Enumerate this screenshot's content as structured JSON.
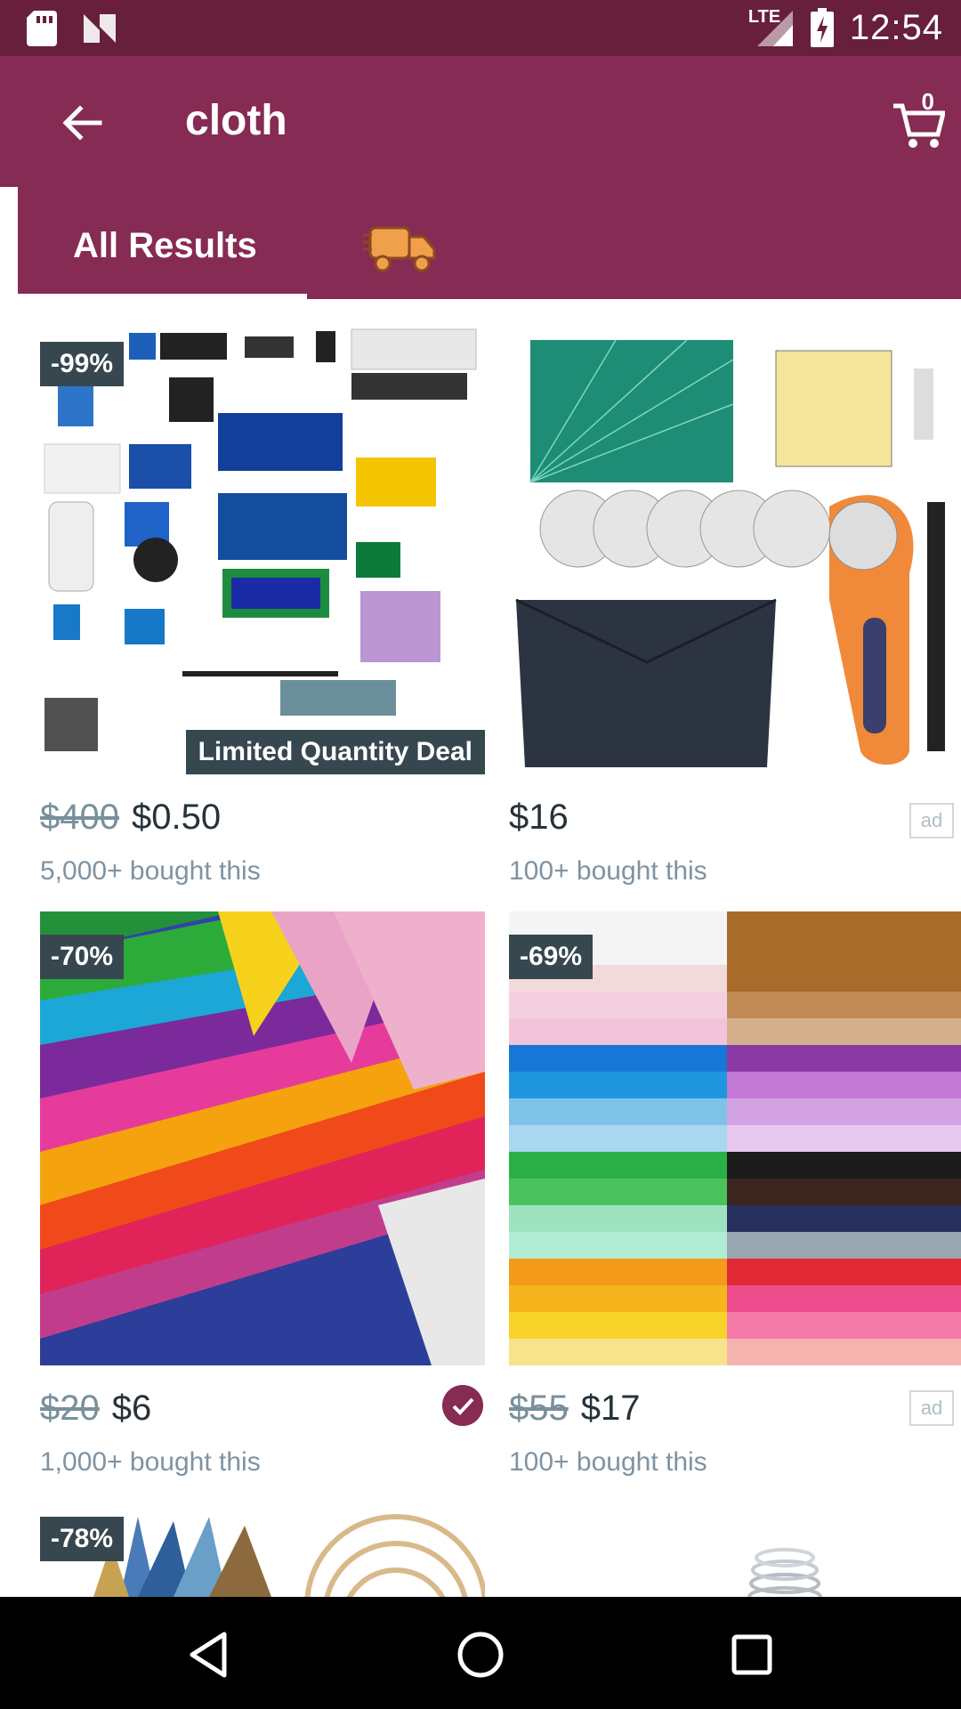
{
  "status_bar": {
    "time": "12:54",
    "network": "LTE",
    "icons": [
      "sd-card-icon",
      "n-icon",
      "signal-icon",
      "battery-charging-icon"
    ]
  },
  "app_bar": {
    "query": "cloth",
    "cart_count": "0",
    "icons": [
      "back-arrow-icon",
      "cart-icon"
    ]
  },
  "tabs": {
    "all_results": "All Results",
    "shipping_icon": "fast-shipping-truck-icon"
  },
  "products": [
    {
      "discount": "-99%",
      "deal": "Limited Quantity Deal",
      "old_price": "$400",
      "price": "$0.50",
      "bought": "5,000+ bought this",
      "image": "electronics-kit"
    },
    {
      "discount": "",
      "old_price": "",
      "price": "$16",
      "bought": "100+ bought this",
      "ad": "ad",
      "image": "cutting-mat-rotary-cutter"
    },
    {
      "discount": "-70%",
      "old_price": "$20",
      "price": "$6",
      "bought": "1,000+ bought this",
      "verified": true,
      "image": "satin-fabric"
    },
    {
      "discount": "-69%",
      "old_price": "$55",
      "price": "$17",
      "bought": "100+ bought this",
      "ad": "ad",
      "image": "cotton-fabric-stack"
    },
    {
      "discount": "-78%",
      "image": "embroidery-threads-hoops"
    },
    {
      "image": "metal-spring"
    }
  ],
  "nav_bar": {
    "icons": [
      "back-triangle-icon",
      "home-circle-icon",
      "recents-square-icon"
    ]
  },
  "colors": {
    "status_bar": "#671f3c",
    "app_bar": "#862b53",
    "badge": "#37474f",
    "price": "#263238",
    "bought_text": "#7e93a3"
  }
}
